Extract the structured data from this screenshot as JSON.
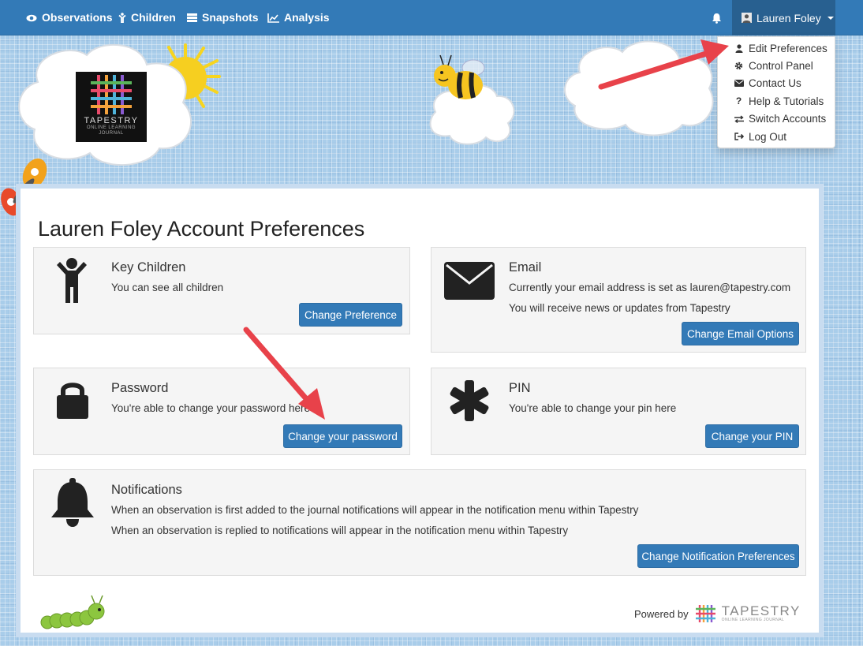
{
  "nav": {
    "items": [
      {
        "label": "Observations",
        "icon": "eye-icon"
      },
      {
        "label": "Children",
        "icon": "child-icon"
      },
      {
        "label": "Snapshots",
        "icon": "snapshots-icon"
      },
      {
        "label": "Analysis",
        "icon": "chart-icon"
      }
    ],
    "user_name": "Lauren Foley"
  },
  "dropdown": {
    "items": [
      {
        "label": "Edit Preferences",
        "icon": "user-icon"
      },
      {
        "label": "Control Panel",
        "icon": "cog-icon"
      },
      {
        "label": "Contact Us",
        "icon": "envelope-icon"
      },
      {
        "label": "Help & Tutorials",
        "icon": "question-icon"
      },
      {
        "label": "Switch Accounts",
        "icon": "switch-icon"
      },
      {
        "label": "Log Out",
        "icon": "logout-icon"
      }
    ]
  },
  "logo": {
    "brand": "TAPESTRY",
    "tagline": "ONLINE LEARNING JOURNAL"
  },
  "page_title": "Lauren Foley Account Preferences",
  "cards": {
    "key_children": {
      "title": "Key Children",
      "lines": [
        "You can see all children"
      ],
      "button": "Change Preference"
    },
    "email": {
      "title": "Email",
      "lines": [
        "Currently your email address is set as lauren@tapestry.com",
        "You will receive news or updates from Tapestry"
      ],
      "button": "Change Email Options"
    },
    "password": {
      "title": "Password",
      "lines": [
        "You're able to change your password here"
      ],
      "button": "Change your password"
    },
    "pin": {
      "title": "PIN",
      "lines": [
        "You're able to change your pin here"
      ],
      "button": "Change your PIN"
    },
    "notifications": {
      "title": "Notifications",
      "lines": [
        "When an observation is first added to the journal notifications will appear in the notification menu within Tapestry",
        "When an observation is replied to notifications will appear in the notification menu within Tapestry"
      ],
      "button": "Change Notification Preferences"
    }
  },
  "footer": {
    "powered_by": "Powered by",
    "brand": "TAPESTRY",
    "tagline": "ONLINE LEARNING JOURNAL"
  },
  "colors": {
    "primary": "#337ab7",
    "arrow": "#e8424a"
  }
}
